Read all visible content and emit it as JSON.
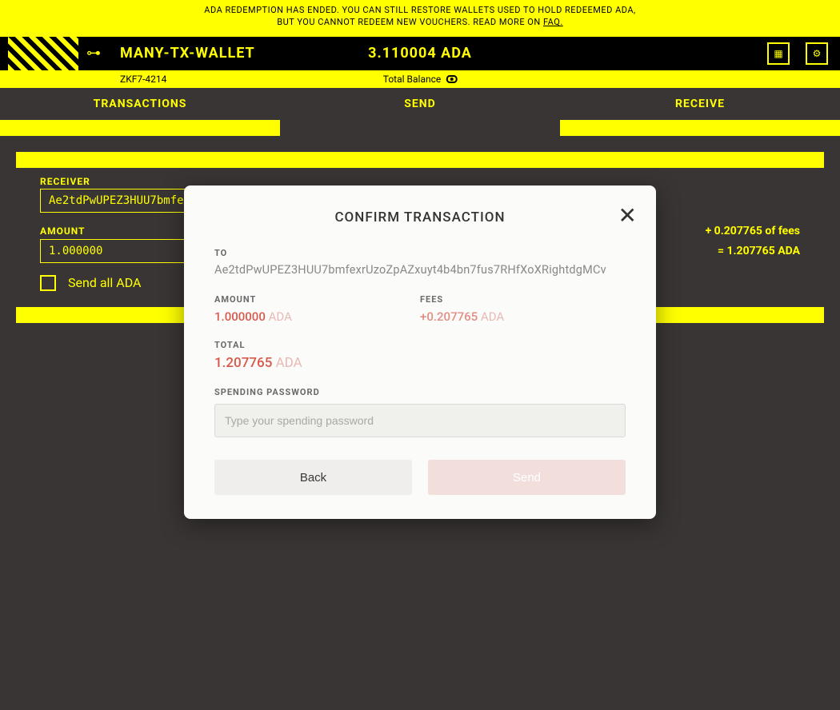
{
  "banner": {
    "line1": "ADA REDEMPTION HAS ENDED. YOU CAN STILL RESTORE WALLETS USED TO HOLD REDEEMED ADA,",
    "line2_prefix": "BUT YOU CANNOT REDEEM NEW VOUCHERS. READ MORE ON ",
    "line2_link": "FAQ."
  },
  "wallet": {
    "name": "MANY-TX-WALLET",
    "sub_id": "ZKF7-4214",
    "balance": "3.110004 ADA",
    "total_balance_label": "Total Balance"
  },
  "tabs": {
    "transactions": "TRANSACTIONS",
    "send": "SEND",
    "receive": "RECEIVE"
  },
  "form": {
    "receiver_label": "RECEIVER",
    "receiver_value": "Ae2tdPwUPEZ3HUU7bmfexrUzoZpAZxuyt4b4bn7fus7RHfXoXRightdgMCv",
    "amount_label": "AMOUNT",
    "amount_value": "1.000000",
    "fee_note": "+ 0.207765 of fees",
    "total_note": "= 1.207765 ADA",
    "send_all_label": "Send all ADA"
  },
  "modal": {
    "title": "CONFIRM TRANSACTION",
    "to_label": "TO",
    "to_value": "Ae2tdPwUPEZ3HUU7bmfexrUzoZpAZxuyt4b4bn7fus7RHfXoXRightdgMCv",
    "amount_label": "AMOUNT",
    "amount_value": "1.000000",
    "amount_currency": "ADA",
    "fees_label": "FEES",
    "fees_value": "+0.207765",
    "fees_currency": "ADA",
    "total_label": "TOTAL",
    "total_value": "1.207765",
    "total_currency": "ADA",
    "password_label": "SPENDING PASSWORD",
    "password_placeholder": "Type your spending password",
    "back_button": "Back",
    "send_button": "Send"
  }
}
